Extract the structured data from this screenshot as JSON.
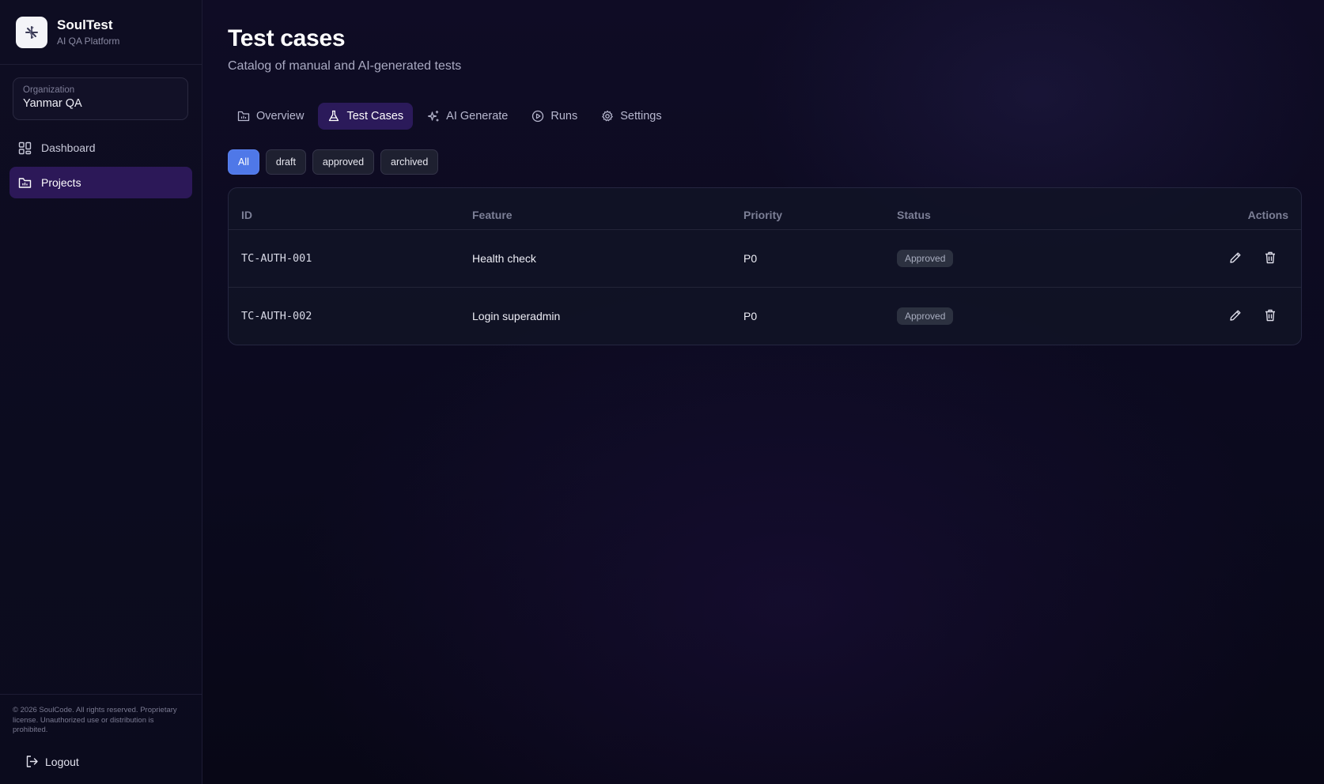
{
  "brand": {
    "name": "SoulTest",
    "subtitle": "AI QA Platform"
  },
  "organization": {
    "label": "Organization",
    "name": "Yanmar QA"
  },
  "sidebar": {
    "items": [
      {
        "label": "Dashboard",
        "icon": "grid-icon",
        "active": false
      },
      {
        "label": "Projects",
        "icon": "folder-icon",
        "active": true
      }
    ],
    "copyright": "© 2026 SoulCode. All rights reserved. Proprietary license. Unauthorized use or distribution is prohibited.",
    "logout_label": "Logout"
  },
  "page": {
    "title": "Test cases",
    "subtitle": "Catalog of manual and AI-generated tests"
  },
  "tabs": [
    {
      "label": "Overview",
      "icon": "folder-icon",
      "active": false
    },
    {
      "label": "Test Cases",
      "icon": "flask-icon",
      "active": true
    },
    {
      "label": "AI Generate",
      "icon": "sparkles-icon",
      "active": false
    },
    {
      "label": "Runs",
      "icon": "play-circle-icon",
      "active": false
    },
    {
      "label": "Settings",
      "icon": "gear-icon",
      "active": false
    }
  ],
  "filters": [
    {
      "label": "All",
      "active": true
    },
    {
      "label": "draft",
      "active": false
    },
    {
      "label": "approved",
      "active": false
    },
    {
      "label": "archived",
      "active": false
    }
  ],
  "table": {
    "headers": {
      "id": "ID",
      "feature": "Feature",
      "priority": "Priority",
      "status": "Status",
      "actions": "Actions"
    },
    "rows": [
      {
        "id": "TC-AUTH-001",
        "feature": "Health check",
        "priority": "P0",
        "status": "Approved"
      },
      {
        "id": "TC-AUTH-002",
        "feature": "Login superadmin",
        "priority": "P0",
        "status": "Approved"
      }
    ]
  },
  "colors": {
    "accent": "#4f78e8",
    "active_nav": "#2c1858",
    "background": "#0b0a1e"
  }
}
